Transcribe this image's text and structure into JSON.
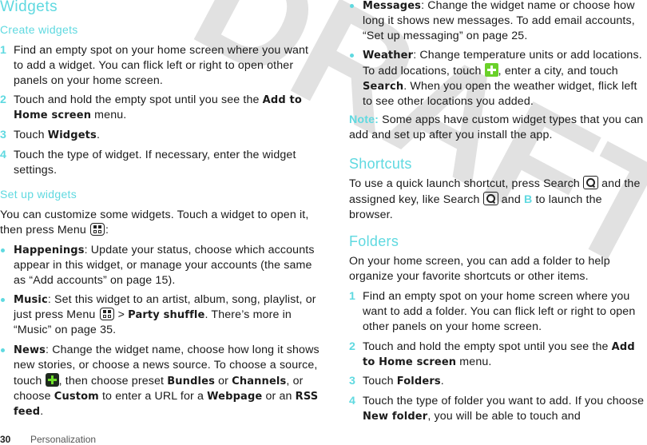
{
  "watermark": {
    "text": "DRAFT",
    "color": "#d9d9d9"
  },
  "left": {
    "title": "Widgets",
    "create_heading": "Create widgets",
    "create_steps": [
      {
        "num": "1",
        "text": "Find an empty spot on your home screen where you want to add a widget. You can flick left or right to open other panels on your home screen."
      },
      {
        "num": "2",
        "pre": "Touch and hold the empty spot until you see the ",
        "bold": "Add to Home screen",
        "post": " menu."
      },
      {
        "num": "3",
        "pre": "Touch ",
        "bold": "Widgets",
        "post": "."
      },
      {
        "num": "4",
        "text": "Touch the type of widget. If necessary, enter the widget settings."
      }
    ],
    "setup_heading": "Set up widgets",
    "setup_intro_pre": "You can customize some widgets. Touch a widget to open it, then press Menu ",
    "setup_intro_post": ":",
    "bullets": {
      "happenings": {
        "bold": "Happenings",
        "text": ": Update your status, choose which accounts appear in this widget, or manage your accounts (the same as “Add accounts” on page 15)."
      },
      "music": {
        "bold": "Music",
        "pre": ": Set this widget to an artist, album, song, playlist, or just press Menu ",
        "mid": " > ",
        "bold2": "Party shuffle",
        "post": ". There’s more in “Music” on page 35."
      },
      "news": {
        "bold": "News",
        "pre": ": Change the widget name, choose how long it shows new stories, or choose a news source. To choose a source, touch ",
        "mid": ", then choose preset ",
        "b1": "Bundles",
        "or1": " or ",
        "b2": "Channels",
        "or2": ", or choose ",
        "b3": "Custom",
        "t3": " to enter a URL for a ",
        "b4": "Webpage",
        "t4": " or an ",
        "b5": "RSS feed",
        "end": "."
      }
    }
  },
  "right": {
    "messages": {
      "bold": "Messages",
      "text": ": Change the widget name or choose how long it shows new messages. To add email accounts, “Set up messaging” on page 25."
    },
    "weather": {
      "bold": "Weather",
      "pre": ": Change temperature units or add locations. To add locations, touch ",
      "mid": ", enter a city, and touch ",
      "bold2": "Search",
      "post": ". When you open the weather widget, flick left to see other locations you added."
    },
    "note": {
      "label": "Note:",
      "text": " Some apps have custom widget types that you can add and set up after you install the app."
    },
    "shortcuts_heading": "Shortcuts",
    "shortcuts": {
      "p1": "To use a quick launch shortcut, press Search ",
      "p2": " and the assigned key, like Search ",
      "p3": " and ",
      "key": "B",
      "p4": " to launch the browser."
    },
    "folders_heading": "Folders",
    "folders_intro": "On your home screen, you can add a folder to help organize your favorite shortcuts or other items.",
    "folder_steps": [
      {
        "num": "1",
        "text": "Find an empty spot on your home screen where you want to add a folder. You can flick left or right to open other panels on your home screen."
      },
      {
        "num": "2",
        "pre": "Touch and hold the empty spot until you see the ",
        "bold": "Add to Home screen",
        "post": " menu."
      },
      {
        "num": "3",
        "pre": "Touch ",
        "bold": "Folders",
        "post": "."
      },
      {
        "num": "4",
        "pre": "Touch the type of folder you want to add. If you choose ",
        "bold": "New folder",
        "post": ", you will be able to touch and"
      }
    ]
  },
  "footer": {
    "page_number": "30",
    "section": "Personalization"
  }
}
